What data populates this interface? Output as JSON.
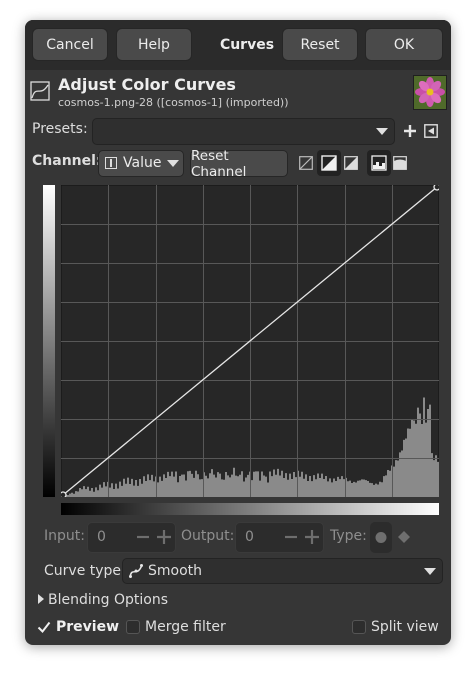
{
  "header": {
    "cancel": "Cancel",
    "help": "Help",
    "title": "Curves",
    "reset": "Reset",
    "ok": "OK"
  },
  "title_section": {
    "title": "Adjust Color Curves",
    "subtitle": "cosmos-1.png-28 ([cosmos-1] (imported))"
  },
  "presets": {
    "label": "Presets:",
    "value": ""
  },
  "channel": {
    "label": "Channel:",
    "value": "Value",
    "reset_label": "Reset Channel"
  },
  "inputs": {
    "input_label": "Input:",
    "input_value": "0",
    "output_label": "Output:",
    "output_value": "0",
    "type_label": "Type:"
  },
  "curve_type": {
    "label": "Curve type:",
    "value": "Smooth"
  },
  "blending": {
    "label": "Blending Options"
  },
  "footer": {
    "preview_label": "Preview",
    "preview_checked": true,
    "merge_label": "Merge filter",
    "merge_checked": false,
    "split_label": "Split view",
    "split_checked": false
  },
  "colors": {
    "dialog_bg": "#363636",
    "graph_bg": "#272727",
    "histogram": "#8a8a8a",
    "curve": "#e6e6e6"
  },
  "icons": {
    "curves_dialog": "curves-icon",
    "thumbnail": "flower-thumbnail",
    "add_preset": "plus-icon",
    "preset_menu": "menu-triangle-icon"
  }
}
